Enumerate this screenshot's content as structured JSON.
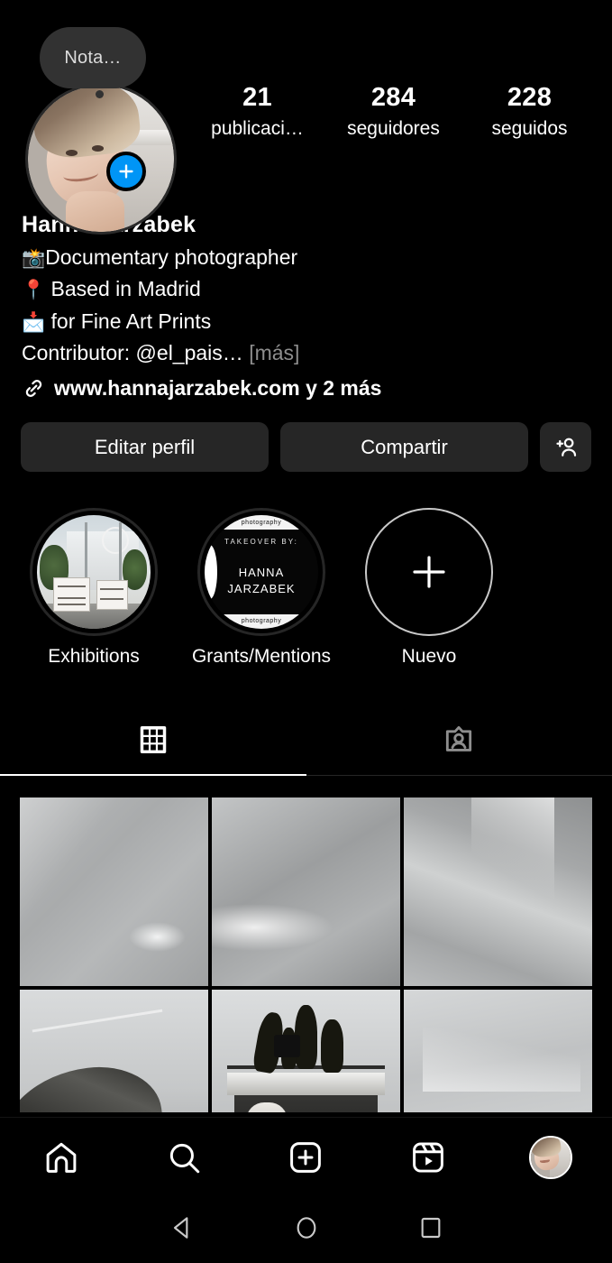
{
  "note": {
    "text": "Nota…"
  },
  "profile": {
    "avatar_name": "profile-avatar",
    "add_story_badge": "plus-badge",
    "display_name": "Hanna Jarzabek",
    "bio": [
      {
        "emoji": "📸",
        "text": "Documentary photographer"
      },
      {
        "emoji": "📍",
        "text": " Based in Madrid"
      },
      {
        "emoji": "📩",
        "text": " for Fine Art Prints"
      }
    ],
    "contributor_line": "Contributor: @el_pais…",
    "more_label": "[más]",
    "link_text": "www.hannajarzabek.com y 2 más"
  },
  "stats": [
    {
      "number": "21",
      "label": "publicaci…"
    },
    {
      "number": "284",
      "label": "seguidores"
    },
    {
      "number": "228",
      "label": "seguidos"
    }
  ],
  "actions": {
    "edit_label": "Editar perfil",
    "share_label": "Compartir",
    "add_person_icon": "add-person-icon"
  },
  "highlights": [
    {
      "label": "Exhibitions",
      "type": "photo"
    },
    {
      "label": "Grants/Mentions",
      "type": "takeover",
      "cover_top_band": "photography",
      "cover_takeover": "TAKEOVER  BY:",
      "cover_name_line1": "HANNA",
      "cover_name_line2": "JARZABEK",
      "cover_bottom_band": "photography"
    },
    {
      "label": "Nuevo",
      "type": "new"
    }
  ],
  "tabs": [
    {
      "name": "grid-tab",
      "icon": "grid-icon",
      "active": true
    },
    {
      "name": "tagged-tab",
      "icon": "tagged-person-icon",
      "active": false
    }
  ],
  "grid_posts": [
    {
      "alt": "grayscale sky with wispy clouds"
    },
    {
      "alt": "grayscale cloudy sky"
    },
    {
      "alt": "grayscale sky with bright cloud edge"
    },
    {
      "alt": "dark debris mound under bright sky"
    },
    {
      "alt": "workers standing on loaded truck"
    },
    {
      "alt": "bright grayscale sky"
    }
  ],
  "bottom_nav": [
    {
      "name": "home-icon",
      "label": "Inicio"
    },
    {
      "name": "search-icon",
      "label": "Buscar"
    },
    {
      "name": "create-icon",
      "label": "Crear"
    },
    {
      "name": "reels-icon",
      "label": "Reels"
    },
    {
      "name": "profile-avatar-icon",
      "label": "Perfil"
    }
  ],
  "system_nav": [
    {
      "name": "back-icon"
    },
    {
      "name": "home-icon"
    },
    {
      "name": "recents-icon"
    }
  ],
  "colors": {
    "background": "#000000",
    "surface": "#262626",
    "accent_blue": "#0095f6",
    "muted_text": "#8e8e8e",
    "note_bubble": "#323232"
  }
}
